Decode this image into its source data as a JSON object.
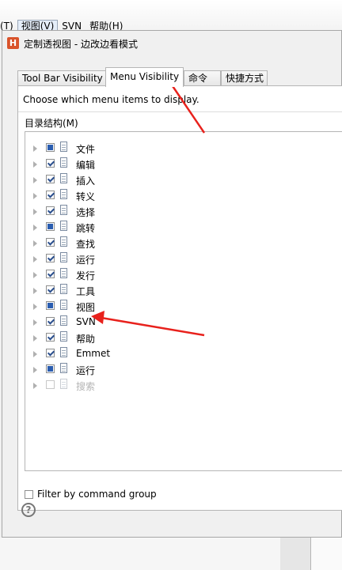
{
  "menubar": {
    "items": [
      {
        "label": "(T)"
      },
      {
        "label": "视图(V)",
        "active": true
      },
      {
        "label": "SVN"
      },
      {
        "label": "帮助(H)"
      }
    ]
  },
  "dialog": {
    "icon_letter": "H",
    "title": "定制透视图 - 边改边看模式",
    "tabs": [
      {
        "label": "Tool Bar Visibility"
      },
      {
        "label": "Menu Visibility",
        "selected": true
      },
      {
        "label": "命令"
      },
      {
        "label": "快捷方式"
      }
    ],
    "prompt": "Choose which menu items to display.",
    "tree_label": "目录结构(M)",
    "tree_items": [
      {
        "label": "文件",
        "state": "partial"
      },
      {
        "label": "编辑",
        "state": "checked"
      },
      {
        "label": "插入",
        "state": "checked"
      },
      {
        "label": "转义",
        "state": "checked"
      },
      {
        "label": "选择",
        "state": "checked"
      },
      {
        "label": "跳转",
        "state": "partial"
      },
      {
        "label": "查找",
        "state": "checked"
      },
      {
        "label": "运行",
        "state": "checked"
      },
      {
        "label": "发行",
        "state": "checked"
      },
      {
        "label": "工具",
        "state": "checked"
      },
      {
        "label": "视图",
        "state": "partial"
      },
      {
        "label": "SVN",
        "state": "checked"
      },
      {
        "label": "帮助",
        "state": "checked"
      },
      {
        "label": "Emmet",
        "state": "checked"
      },
      {
        "label": "运行",
        "state": "partial"
      },
      {
        "label": "搜索",
        "state": "disabled"
      }
    ],
    "filter_label": "Filter by command group",
    "help_glyph": "?"
  },
  "colors": {
    "annotation_red": "#e8211c",
    "checkbox_fill": "#2a5db0"
  }
}
